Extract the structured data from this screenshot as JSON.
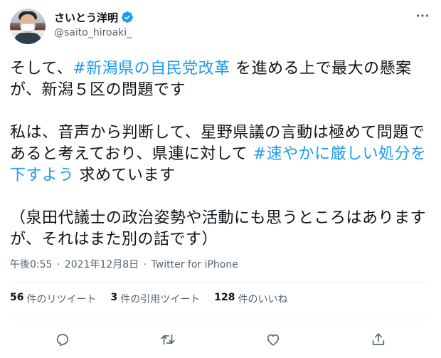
{
  "author": {
    "display_name": "さいとう洋明",
    "handle": "@saito_hiroaki_"
  },
  "tweet": {
    "p1_a": "そして、",
    "p1_tag": "#新潟県の自民党改革",
    "p1_b": " を進める上で最大の懸案が、新潟５区の問題です",
    "p2_a": "私は、音声から判断して、星野県議の言動は極めて問題であると考えており、県連に対して ",
    "p2_tag": "#速やかに厳しい処分を下すよう",
    "p2_b": " 求めています",
    "p3": "（泉田代議士の政治姿勢や活動にも思うところはありますが、それはまた別の話です）"
  },
  "meta": {
    "time": "午後0:55",
    "sep1": " · ",
    "date": "2021年12月8日",
    "sep2": " · ",
    "source": "Twitter for iPhone"
  },
  "stats": {
    "retweets_count": "56",
    "retweets_label": "件のリツイート",
    "quotes_count": "3",
    "quotes_label": "件の引用ツイート",
    "likes_count": "128",
    "likes_label": "件のいいね"
  },
  "actions": {
    "icons": [
      "reply-icon",
      "retweet-icon",
      "like-icon",
      "share-icon"
    ]
  },
  "colors": {
    "hashtag": "#1d9bf0",
    "verified": "#1d9bf0",
    "muted": "#536471",
    "text": "#0f1419"
  }
}
